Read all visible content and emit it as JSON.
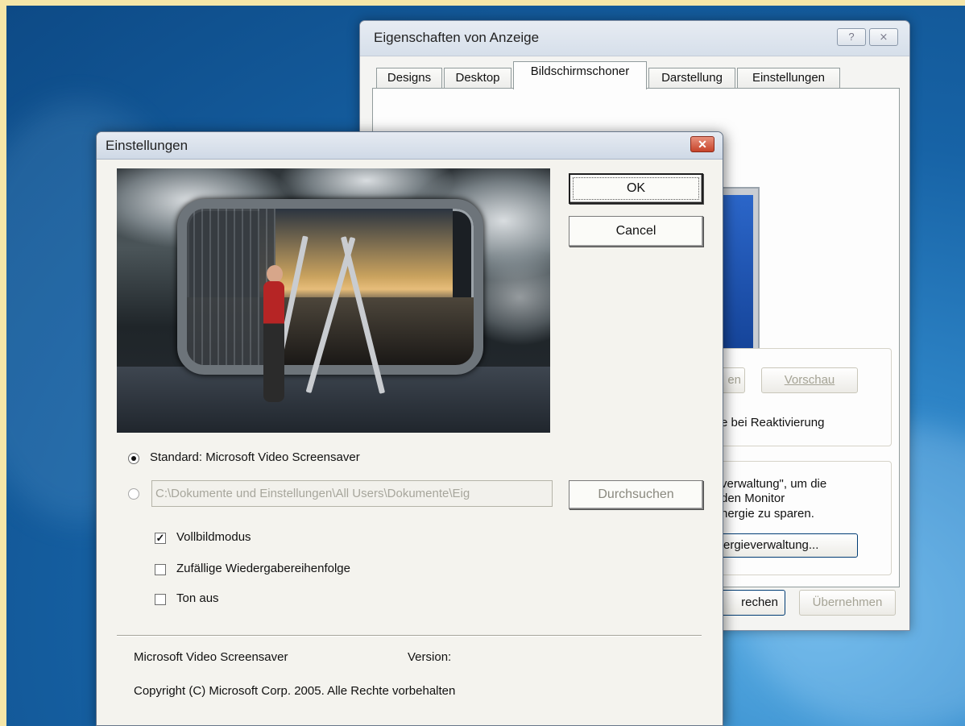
{
  "back_window": {
    "title": "Eigenschaften von Anzeige",
    "help_button": "?",
    "close_button": "⨯",
    "tabs": [
      {
        "label": "Designs",
        "active": false
      },
      {
        "label": "Desktop",
        "active": false
      },
      {
        "label": "Bildschirmschoner",
        "active": true
      },
      {
        "label": "Darstellung",
        "active": false
      },
      {
        "label": "Einstellungen",
        "active": false
      }
    ],
    "settings_button_fragment": "en",
    "preview_button": "Vorschau",
    "reactivation_text": "e bei Reaktivierung",
    "energy_text_line1": "verwaltung\", um die",
    "energy_text_line2": "den Monitor",
    "energy_text_line3": "nergie zu sparen.",
    "energy_button": "ergieverwaltung...",
    "cancel_fragment": "rechen",
    "apply_button": "Übernehmen"
  },
  "dialog": {
    "title": "Einstellungen",
    "close_icon": "✕",
    "ok_button": "OK",
    "cancel_button": "Cancel",
    "radio_standard_label": "Standard: Microsoft Video Screensaver",
    "radio_standard_checked": true,
    "path_value": "C:\\Dokumente und Einstellungen\\All Users\\Dokumente\\Eig",
    "browse_button": "Durchsuchen",
    "checkboxes": [
      {
        "label": "Vollbildmodus",
        "checked": true
      },
      {
        "label": "Zufällige Wiedergabereihenfolge",
        "checked": false
      },
      {
        "label": "Ton aus",
        "checked": false
      }
    ],
    "product_name": "Microsoft Video Screensaver",
    "version_label": "Version:",
    "copyright": "Copyright (C) Microsoft Corp. 2005. Alle Rechte vorbehalten"
  }
}
